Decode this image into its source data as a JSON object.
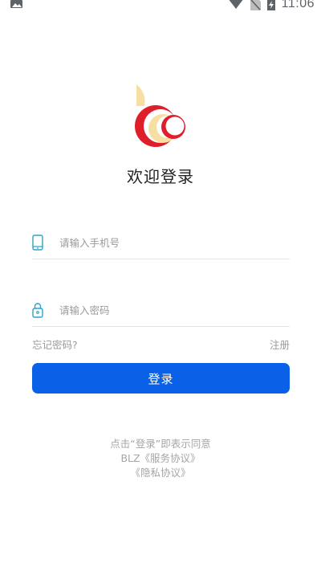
{
  "status_bar": {
    "time": "11:06",
    "left_icon": "image-icon",
    "right_icons": [
      "wifi-icon",
      "no-sim-icon",
      "battery-charging-icon"
    ]
  },
  "app": {
    "logo": "blz-logo",
    "title": "欢迎登录"
  },
  "form": {
    "phone": {
      "icon": "phone-icon",
      "placeholder": "请输入手机号",
      "value": ""
    },
    "password": {
      "icon": "lock-icon",
      "placeholder": "请输入密码",
      "value": ""
    },
    "forgot_label": "忘记密码?",
    "register_label": "注册",
    "login_label": "登录"
  },
  "agreement": {
    "line1": "点击“登录”即表示同意",
    "line2": "BLZ《服务协议》",
    "line3": "《隐私协议》"
  },
  "colors": {
    "primary": "#0a61e8",
    "icon_teal": "#2aa3c8",
    "logo_red": "#e01e2b",
    "logo_cream": "#f7dfa3"
  }
}
